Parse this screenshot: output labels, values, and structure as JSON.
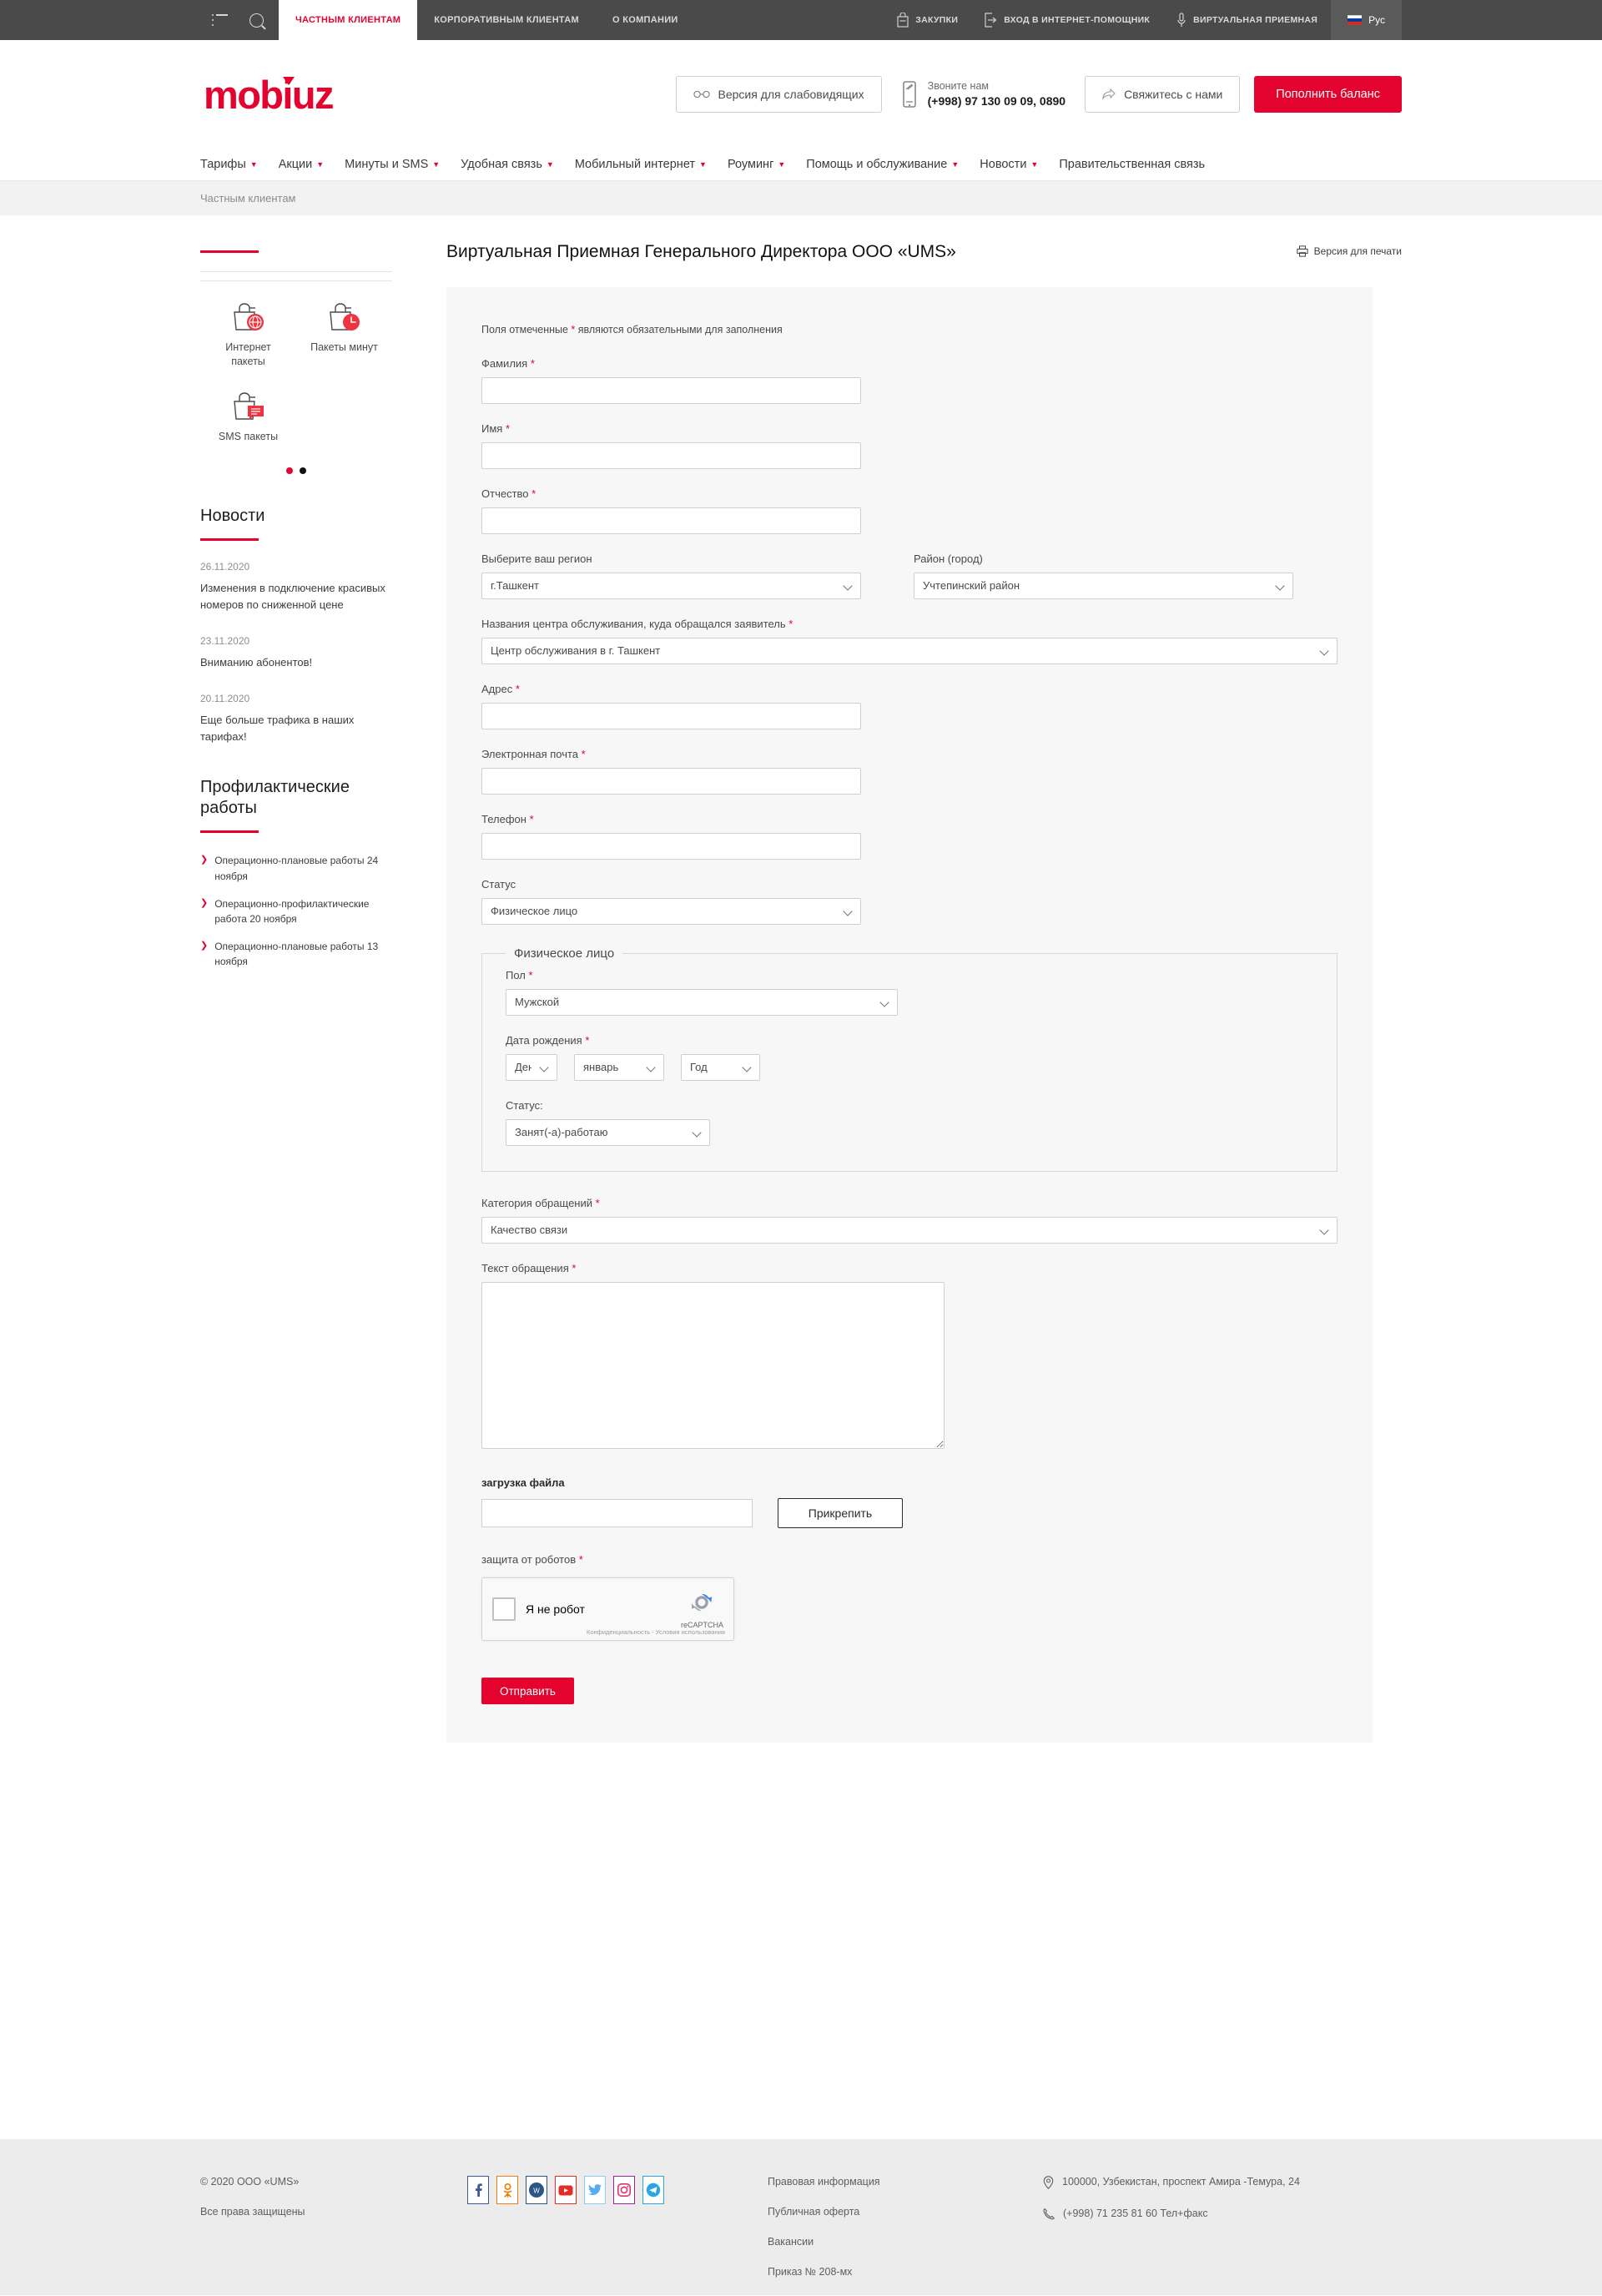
{
  "topbar": {
    "icons": {
      "menu": "burger-menu-icon",
      "search": "search-icon"
    },
    "tabs": [
      {
        "label": "ЧАСТНЫМ КЛИЕНТАМ",
        "active": true
      },
      {
        "label": "КОРПОРАТИВНЫМ КЛИЕНТАМ",
        "active": false
      },
      {
        "label": "О КОМПАНИИ",
        "active": false
      }
    ],
    "links": [
      {
        "label": "ЗАКУПКИ",
        "icon": "cart-icon"
      },
      {
        "label": "ВХОД В ИНТЕРНЕТ-ПОМОЩНИК",
        "icon": "login-icon"
      },
      {
        "label": "ВИРТУАЛЬНАЯ ПРИЕМНАЯ",
        "icon": "microphone-icon"
      }
    ],
    "language": "Рус"
  },
  "header": {
    "logo": "mobiuz",
    "accessibility_button": "Версия для слабовидящих",
    "call_us_label": "Звоните нам",
    "phone": "(+998) 97 130 09 09, 0890",
    "contact_button": "Свяжитесь с нами",
    "topup_button": "Пополнить баланс"
  },
  "nav": [
    {
      "label": "Тарифы",
      "caret": true
    },
    {
      "label": "Акции",
      "caret": true
    },
    {
      "label": "Минуты и SMS",
      "caret": true
    },
    {
      "label": "Удобная связь",
      "caret": true
    },
    {
      "label": "Мобильный интернет",
      "caret": true
    },
    {
      "label": "Роуминг",
      "caret": true
    },
    {
      "label": "Помощь и обслуживание",
      "caret": true
    },
    {
      "label": "Новости",
      "caret": true
    },
    {
      "label": "Правительственная связь",
      "caret": false
    }
  ],
  "breadcrumb": "Частным клиентам",
  "sidebar": {
    "promos": [
      {
        "label": "Интернет\nпакеты",
        "icon": "internet-package-icon"
      },
      {
        "label": "Пакеты минут",
        "icon": "minutes-package-icon"
      },
      {
        "label": "SMS пакеты",
        "icon": "sms-package-icon"
      }
    ],
    "carousel_dots": 2,
    "news_heading": "Новости",
    "news": [
      {
        "date": "26.11.2020",
        "title": "Изменения в подключение красивых номеров по сниженной цене"
      },
      {
        "date": "23.11.2020",
        "title": "Вниманию абонентов!"
      },
      {
        "date": "20.11.2020",
        "title": "Еще больше трафика в наших тарифах!"
      }
    ],
    "works_heading": "Профилактические работы",
    "works": [
      "Операционно-плановые работы 24 ноября",
      "Операционно-профилактические работа 20 ноября",
      "Операционно-плановые работы 13 ноября"
    ]
  },
  "main": {
    "title": "Виртуальная Приемная Генерального Директора ООО «UMS»",
    "print_link": "Версия для печати",
    "required_note_pre": "Поля отмеченные ",
    "required_note_post": " являются обязательными для заполнения",
    "fields": {
      "surname": {
        "label": "Фамилия",
        "required": true,
        "value": ""
      },
      "name": {
        "label": "Имя",
        "required": true,
        "value": ""
      },
      "patronymic": {
        "label": "Отчество",
        "required": true,
        "value": ""
      },
      "region": {
        "label": "Выберите ваш регион",
        "required": false,
        "value": "г.Ташкент"
      },
      "district": {
        "label": "Район (город)",
        "required": false,
        "value": "Учтепинский район"
      },
      "center": {
        "label": "Названия центра обслуживания, куда обращался заявитель",
        "required": true,
        "value": "Центр обслуживания в г. Ташкент"
      },
      "address": {
        "label": "Адрес",
        "required": true,
        "value": ""
      },
      "email": {
        "label": "Электронная почта",
        "required": true,
        "value": ""
      },
      "phone": {
        "label": "Телефон",
        "required": true,
        "value": ""
      },
      "status": {
        "label": "Статус",
        "required": false,
        "value": "Физическое лицо"
      },
      "person_legend": "Физическое лицо",
      "gender": {
        "label": "Пол",
        "required": true,
        "value": "Мужской"
      },
      "dob": {
        "label": "Дата рождения",
        "required": true,
        "day": "День",
        "month": "январь",
        "year": "Год"
      },
      "employment": {
        "label": "Статус:",
        "required": false,
        "value": "Занят(-а)-работаю"
      },
      "category": {
        "label": "Категория обращений",
        "required": true,
        "value": "Качество связи"
      },
      "message": {
        "label": "Текст обращения",
        "required": true,
        "value": ""
      },
      "upload": {
        "label": "загрузка файла",
        "value": "",
        "button": "Прикрепить"
      },
      "captcha": {
        "label": "защита от роботов",
        "required": true,
        "checkbox_label": "Я не робот",
        "brand": "reCAPTCHA",
        "fineprint": "Конфиденциальность - Условия использования"
      }
    },
    "submit_button": "Отправить"
  },
  "footer": {
    "copyright": "© 2020 ООО «UMS»",
    "rights": "Все права защищены",
    "socials": [
      {
        "name": "facebook-icon",
        "glyph": "f",
        "color": "#3b5998"
      },
      {
        "name": "odnoklassniki-icon",
        "glyph": "२",
        "color": "#ee8208"
      },
      {
        "name": "vk-icon",
        "glyph": "w",
        "color": "#2a5885"
      },
      {
        "name": "youtube-icon",
        "glyph": "▶",
        "color": "#e52d27"
      },
      {
        "name": "twitter-icon",
        "glyph": "✓",
        "color": "#55acee"
      },
      {
        "name": "instagram-icon",
        "glyph": "◎",
        "color": "#9b258f"
      },
      {
        "name": "telegram-icon",
        "glyph": "➤",
        "color": "#2ca5e0"
      }
    ],
    "links": [
      "Правовая информация",
      "Публичная оферта",
      "Вакансии",
      "Приказ № 208-мх"
    ],
    "address": "100000, Узбекистан, проспект Амира -Темура, 24",
    "phone": "(+998) 71 235 81 60 Тел+факс"
  },
  "colors": {
    "brand_red": "#e3032e",
    "topbar_bg": "#4a4a4a",
    "form_bg": "#f7f7f7",
    "footer_bg": "#ececec"
  }
}
